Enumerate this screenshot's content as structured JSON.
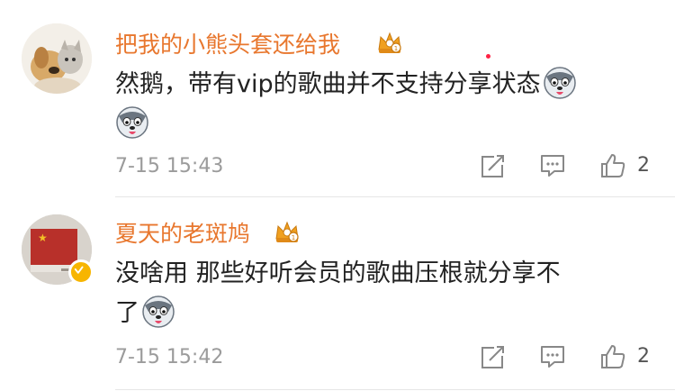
{
  "comments": [
    {
      "username": "把我的小熊头套还给我",
      "text_line1": "然鹅，带有vip的歌曲并不支持分享状态",
      "text_line2": "",
      "time": "7-15 15:43",
      "like_count": "2",
      "emoji": "husky-emoji"
    },
    {
      "username": "夏天的老斑鸠",
      "text_line1": "没啥用  那些好听会员的歌曲压根就分享不",
      "text_line2": "了",
      "time": "7-15 15:42",
      "like_count": "2",
      "emoji": "husky-emoji"
    }
  ],
  "colors": {
    "username": "#e8772e",
    "crown": "#f0a020",
    "verified": "#f7b500",
    "meta": "#9b9b9b"
  },
  "icons": [
    "crown-icon",
    "forward-icon",
    "comment-icon",
    "like-icon",
    "verified-badge-icon"
  ]
}
